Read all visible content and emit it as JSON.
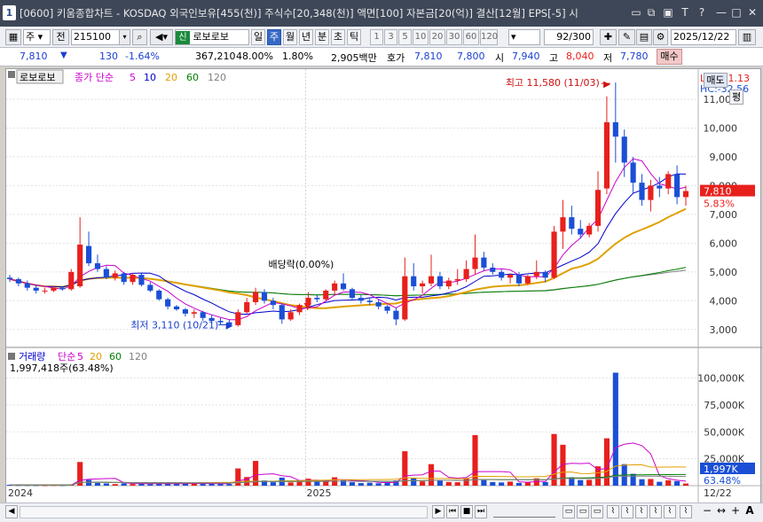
{
  "window": {
    "number": "1",
    "title": "[0600] 키움종합차트 - KOSDAQ 외국인보유[455(천)] 주식수[20,348(천)] 액면[100] 자본금[20(억)] 결산[12월] EPS[-5] 시"
  },
  "toolbar": {
    "mode": "주",
    "prev_label": "전",
    "code": "215100",
    "stock_tag": "신",
    "stock_name": "로보로보",
    "periods": [
      "일",
      "주",
      "월",
      "년",
      "분",
      "초",
      "틱"
    ],
    "selected_period": "주",
    "minute_options": [
      "1",
      "3",
      "5",
      "10",
      "20",
      "30",
      "60",
      "120"
    ],
    "count": "92/300",
    "date": "2025/12/22"
  },
  "quote": {
    "price": "7,810",
    "change_arrow": "▼",
    "change": "130",
    "change_pct": "-1.64%",
    "volume": "367,210",
    "vol_ratio": "48.00%",
    "turnover": "1.80%",
    "amount": "2,905백만",
    "ask_label": "호가",
    "ask": "7,810",
    "bid": "7,800",
    "open_label": "시",
    "open": "7,940",
    "high_label": "고",
    "high": "8,040",
    "low_label": "저",
    "low": "7,780",
    "buy_btn": "매수",
    "sell_btn": "매도",
    "eval_btn": "평"
  },
  "price_panel": {
    "name_tag": "로보로보",
    "legend": [
      {
        "label": "종가 단순",
        "color": "#cc00cc"
      },
      {
        "label": "5",
        "color": "#cc00cc"
      },
      {
        "label": "10",
        "color": "#0000cc"
      },
      {
        "label": "20",
        "color": "#e0a000"
      },
      {
        "label": "60",
        "color": "#008000"
      },
      {
        "label": "120",
        "color": "#808080"
      }
    ],
    "lc": "LC:151.13",
    "hc": "HC:-32.56",
    "price_badge": "7,810",
    "pct_badge": "5.83%",
    "annotations": {
      "high": "최고 11,580 (11/03)",
      "low": "최저 3,110 (10/21)",
      "dividend": "배당락(0.00%)"
    },
    "axis": {
      "min": 2500,
      "max": 11800,
      "ticks": [
        11000,
        10000,
        9000,
        8000,
        7000,
        6000,
        5000,
        4000,
        3000
      ],
      "tick_labels": [
        "11,000",
        "10,000",
        "9,000",
        "8,000",
        "7,000",
        "6,000",
        "5,000",
        "4,000",
        "3,000"
      ]
    }
  },
  "volume_panel": {
    "legend": [
      {
        "label": "거래량",
        "color": "#0000cc"
      },
      {
        "label": "단순",
        "color": "#cc00cc"
      },
      {
        "label": "5",
        "color": "#cc00cc"
      },
      {
        "label": "20",
        "color": "#e0a000"
      },
      {
        "label": "60",
        "color": "#008000"
      },
      {
        "label": "120",
        "color": "#808080"
      }
    ],
    "current": "1,997,418주(63.48%)",
    "vol_badge": "1,997K",
    "pct_badge": "63.48%",
    "axis": {
      "max": 112000,
      "ticks": [
        100000,
        75000,
        50000,
        25000
      ],
      "tick_labels": [
        "100,000K",
        "75,000K",
        "50,000K",
        "25,000K"
      ]
    }
  },
  "x_axis": {
    "labels": [
      "2024",
      "2025"
    ],
    "last_date": "12/22"
  },
  "chart_data": {
    "type": "candlestick",
    "interval": "weekly",
    "colors": {
      "up": "#e8201c",
      "down": "#1a4fd6",
      "ma5": "#cc00cc",
      "ma10": "#0000cc",
      "ma20": "#e0a000",
      "ma60": "#008000",
      "ma120": "#808080"
    },
    "candles": [
      [
        4800,
        4900,
        4650,
        4750
      ],
      [
        4750,
        4800,
        4500,
        4600
      ],
      [
        4600,
        4700,
        4350,
        4450
      ],
      [
        4450,
        4550,
        4250,
        4350
      ],
      [
        4350,
        4450,
        4250,
        4350
      ],
      [
        4350,
        4500,
        4300,
        4450
      ],
      [
        4450,
        4500,
        4350,
        4400
      ],
      [
        4400,
        5100,
        4350,
        5000
      ],
      [
        4500,
        6900,
        4450,
        5950
      ],
      [
        5900,
        6400,
        5200,
        5300
      ],
      [
        5300,
        5600,
        5000,
        5100
      ],
      [
        5100,
        5200,
        4750,
        4800
      ],
      [
        4800,
        5050,
        4700,
        4950
      ],
      [
        4950,
        5000,
        4550,
        4650
      ],
      [
        4650,
        4950,
        4550,
        4900
      ],
      [
        4900,
        4950,
        4500,
        4550
      ],
      [
        4550,
        4650,
        4300,
        4350
      ],
      [
        4350,
        4400,
        4000,
        4050
      ],
      [
        4050,
        4100,
        3700,
        3800
      ],
      [
        3800,
        3850,
        3650,
        3700
      ],
      [
        3700,
        3750,
        3450,
        3550
      ],
      [
        3550,
        3700,
        3400,
        3600
      ],
      [
        3600,
        3650,
        3300,
        3400
      ],
      [
        3400,
        3500,
        3200,
        3300
      ],
      [
        3300,
        3400,
        3150,
        3250
      ],
      [
        3250,
        3350,
        3110,
        3150
      ],
      [
        3150,
        3700,
        3100,
        3600
      ],
      [
        3600,
        4100,
        3550,
        3950
      ],
      [
        3950,
        4450,
        3850,
        4300
      ],
      [
        4300,
        4400,
        3900,
        4000
      ],
      [
        4000,
        4100,
        3700,
        3850
      ],
      [
        3850,
        3900,
        3200,
        3350
      ],
      [
        3350,
        3700,
        3300,
        3600
      ],
      [
        3600,
        3900,
        3500,
        3850
      ],
      [
        3850,
        4300,
        3800,
        4100
      ],
      [
        4100,
        4200,
        3950,
        4050
      ],
      [
        4050,
        4400,
        4000,
        4350
      ],
      [
        4350,
        4700,
        4200,
        4600
      ],
      [
        4600,
        4950,
        4350,
        4400
      ],
      [
        4400,
        4450,
        4000,
        4100
      ],
      [
        4100,
        4200,
        3900,
        4000
      ],
      [
        4000,
        4100,
        3850,
        3950
      ],
      [
        3950,
        4050,
        3700,
        3800
      ],
      [
        3800,
        3850,
        3550,
        3650
      ],
      [
        3650,
        3750,
        3150,
        3350
      ],
      [
        3350,
        5500,
        3300,
        4850
      ],
      [
        4850,
        5300,
        4350,
        4500
      ],
      [
        4500,
        4700,
        4250,
        4600
      ],
      [
        4600,
        5600,
        4500,
        4850
      ],
      [
        4850,
        5000,
        4400,
        4500
      ],
      [
        4500,
        4800,
        4400,
        4700
      ],
      [
        4700,
        5100,
        4550,
        4750
      ],
      [
        4750,
        5400,
        4650,
        5100
      ],
      [
        5100,
        6300,
        4900,
        5500
      ],
      [
        5500,
        5700,
        5050,
        5150
      ],
      [
        5150,
        5300,
        4900,
        5000
      ],
      [
        5000,
        5100,
        4700,
        4800
      ],
      [
        4800,
        4950,
        4600,
        4900
      ],
      [
        4900,
        5000,
        4500,
        4600
      ],
      [
        4600,
        4900,
        4550,
        4850
      ],
      [
        4850,
        5400,
        4750,
        5000
      ],
      [
        5000,
        5050,
        4650,
        4800
      ],
      [
        4800,
        6600,
        4750,
        6400
      ],
      [
        6400,
        7500,
        5800,
        6900
      ],
      [
        6900,
        7300,
        6300,
        6500
      ],
      [
        6500,
        6800,
        6150,
        6300
      ],
      [
        6300,
        6700,
        6200,
        6600
      ],
      [
        6600,
        8500,
        6400,
        7850
      ],
      [
        7900,
        11100,
        7700,
        10200
      ],
      [
        10200,
        11580,
        8800,
        9700
      ],
      [
        9700,
        9950,
        8300,
        8800
      ],
      [
        8800,
        9000,
        7700,
        8100
      ],
      [
        8100,
        8400,
        7300,
        7500
      ],
      [
        7500,
        8200,
        7100,
        8000
      ],
      [
        8000,
        8300,
        7600,
        7900
      ],
      [
        7900,
        8500,
        7700,
        8400
      ],
      [
        8400,
        8700,
        7350,
        7600
      ],
      [
        7600,
        8000,
        7300,
        7810
      ]
    ],
    "volumes": [
      820,
      650,
      600,
      560,
      480,
      600,
      560,
      940,
      22000,
      5400,
      2600,
      2100,
      1500,
      2200,
      1500,
      2200,
      1500,
      1900,
      2100,
      1800,
      2300,
      2100,
      1600,
      2000,
      1600,
      1500,
      16000,
      8000,
      23000,
      4800,
      3200,
      7500,
      3000,
      4800,
      6500,
      4200,
      4500,
      7800,
      5000,
      3200,
      2400,
      2800,
      2200,
      3200,
      4800,
      32000,
      6800,
      4000,
      20000,
      4600,
      3400,
      3200,
      6800,
      47000,
      5200,
      3400,
      3000,
      3800,
      2600,
      3200,
      6800,
      3400,
      48000,
      38000,
      7800,
      5200,
      5400,
      18000,
      44000,
      105000,
      20000,
      11000,
      6000,
      6200,
      3600,
      5000,
      4200,
      1997
    ]
  }
}
